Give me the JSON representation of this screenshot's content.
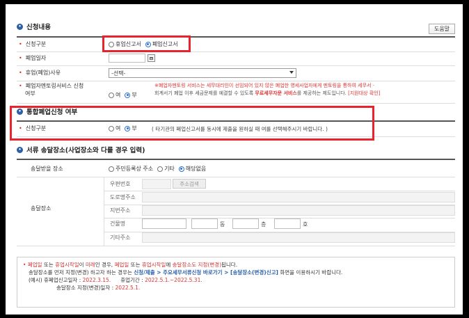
{
  "section1": {
    "title": "신청내용",
    "help_label": "도움말",
    "report_type": {
      "label": "신청구분",
      "options": [
        "휴업신고서",
        "폐업신고서"
      ],
      "selected": 1
    },
    "closure_date": {
      "label": "폐업일자",
      "value": ""
    },
    "reason": {
      "label": "휴업(폐업)사유",
      "value": "-선택-"
    },
    "mentoring": {
      "label_line1": "폐업자멘토링서비스 신청",
      "label_line2": "여부",
      "options": [
        "여",
        "부"
      ],
      "selected": 1,
      "desc_line1": "※폐업자멘토링 서비스는 세무대리인이 선임되어 있지 않은 폐업한 영세사업자에게 멘토링을 통하여 세무서 ·",
      "desc_line2_a": "회계서기 폐업 이후 세금문제를 예결할 수 있도록 ",
      "desc_line2_b": "무료세무자문 서비스",
      "desc_line2_c": "를 제공하는 제도입니다. ",
      "desc_line2_d": "[지원대상 확인]"
    }
  },
  "section2": {
    "title": "통합폐업신청 여부",
    "label": "신청구분",
    "options": [
      "여",
      "부"
    ],
    "selected": 1,
    "desc": "( 타기관의 폐업신고서를 동시에 제출을 원하실 때 여를 선택해주시기 바랍니다. )"
  },
  "section3": {
    "title": "서류 송달장소(사업장소와 다를 경우 입력)",
    "receive_label": "송달받을 장소",
    "receive_options": [
      "주민등록상 주소",
      "기타",
      "해당없음"
    ],
    "receive_selected": 2,
    "place_label": "송달장소",
    "zip_label": "우편번호",
    "zip_button": "주소검색",
    "road_label": "도로명주소",
    "jibun_label": "지번주소",
    "building_label": "건물명",
    "dong_unit": "동",
    "floor_unit": "층",
    "ho_unit": "호",
    "other_label": "기타주소"
  },
  "notice": {
    "line1": [
      {
        "t": "폐업일",
        "c": "red"
      },
      {
        "t": " 또는 ",
        "c": ""
      },
      {
        "t": "휴업시작일",
        "c": "red"
      },
      {
        "t": "이 ",
        "c": ""
      },
      {
        "t": "미래",
        "c": "red"
      },
      {
        "t": "인 경우, ",
        "c": ""
      },
      {
        "t": "폐업일",
        "c": "red"
      },
      {
        "t": " 또는 ",
        "c": ""
      },
      {
        "t": "휴업시작일",
        "c": "red"
      },
      {
        "t": "에 ",
        "c": ""
      },
      {
        "t": "송달장소도 지정(변경)",
        "c": "red"
      },
      {
        "t": "됩니다.",
        "c": ""
      }
    ],
    "line2_a": "송달장소를 먼저 지정(변경) 하고자 하는 경우는 ",
    "line2_b": "신청/제출 > 주요세무서류신청 바로가기 > [송달장소(변경)신고]",
    "line2_c": " 화면을 이용하시기 바랍니다.",
    "line3_a": "(예시) 휴폐업신고일자 : ",
    "line3_b": "2022.3.15.",
    "line3_c": "휴업기간 : ",
    "line3_d": "2022.5.1.~2022.5.31.",
    "line4_a": "송달장소 지정(변경)일자 : ",
    "line4_b": "2022.5.1."
  },
  "colors": {
    "accent": "#2b5fa8",
    "highlight": "#e8232c",
    "warning": "#d33333"
  }
}
